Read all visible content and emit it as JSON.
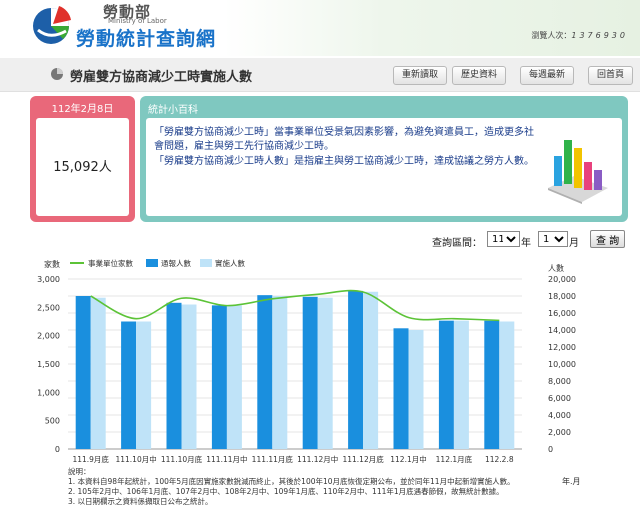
{
  "header": {
    "ministry_zh": "勞動部",
    "ministry_en": "Ministry of Labor",
    "site_title": "勞動統計查詢網",
    "visitor_label": "瀏覽人次：",
    "visitor_count": "1376930",
    "logo_icon": "ministry-logo-icon"
  },
  "titlebar": {
    "title": "勞雇雙方協商減少工時實施人數",
    "buttons": [
      "重新讀取",
      "歷史資料",
      "每週最新",
      "回首頁"
    ]
  },
  "date_panel": {
    "date": "112年2月8日",
    "value": "15,092人"
  },
  "stats_panel": {
    "label": "統計小百科",
    "paragraphs": [
      "「勞雇雙方協商減少工時」當事業單位受景氣因素影響，為避免資遣員工，造成更多社會問題，雇主與勞工先行協商減少工時。",
      "「勞雇雙方協商減少工時人數」是指雇主與勞工協商減少工時，達成協議之勞方人數。"
    ]
  },
  "query": {
    "label": "查詢區間：",
    "year": "112",
    "year_unit": "年",
    "month": "1",
    "month_unit": "月",
    "button": "查 詢"
  },
  "colors": {
    "bar_reported": "#1a8fde",
    "bar_actual": "#bfe3f8",
    "line_units": "#5cc337"
  },
  "chart_data": {
    "type": "bar",
    "left_axis_label": "家數",
    "right_axis_label": "人數",
    "x_axis_label": "年.月",
    "categories": [
      "111.9月底",
      "111.10月中",
      "111.10月底",
      "111.11月中",
      "111.11月底",
      "111.12月中",
      "111.12月底",
      "112.1月中",
      "112.1月底",
      "112.2.8"
    ],
    "left_ticks": [
      "0",
      "500",
      "1,000",
      "1,500",
      "2,000",
      "2,500",
      "3,000"
    ],
    "right_ticks": [
      "0",
      "2,000",
      "4,000",
      "6,000",
      "8,000",
      "10,000",
      "12,000",
      "14,000",
      "16,000",
      "18,000",
      "20,000"
    ],
    "left_ylim": [
      0,
      3000
    ],
    "right_ylim": [
      0,
      20000
    ],
    "grid": true,
    "legend": "top-left",
    "series": [
      {
        "name": "事業單位家數",
        "type": "line",
        "axis": "left",
        "values": [
          2700,
          2300,
          2660,
          2530,
          2650,
          2730,
          2770,
          2320,
          2300,
          2270
        ]
      },
      {
        "name": "通報人數",
        "type": "bar",
        "axis": "right",
        "values": [
          18000,
          15000,
          17200,
          16900,
          18100,
          17900,
          18600,
          14200,
          15100,
          15092
        ]
      },
      {
        "name": "實施人數",
        "type": "bar",
        "axis": "right",
        "values": [
          17800,
          15000,
          17000,
          16900,
          18000,
          17800,
          18500,
          14000,
          15100,
          15000
        ]
      }
    ]
  },
  "notes": {
    "heading": "說明：",
    "lines": [
      "1. 本資料自98年起統計，100年5月底因實施家數銳減而終止，其後於100年10月底恢復定期公布，並於同年11月中起新增實施人數。",
      "2. 105年2月中、106年1月底、107年2月中、108年2月中、109年1月底、110年2月中、111年1月底遇春節假，故無統計數據。",
      "3. 以日期欄示之資料係擷取日公布之統計。"
    ]
  }
}
